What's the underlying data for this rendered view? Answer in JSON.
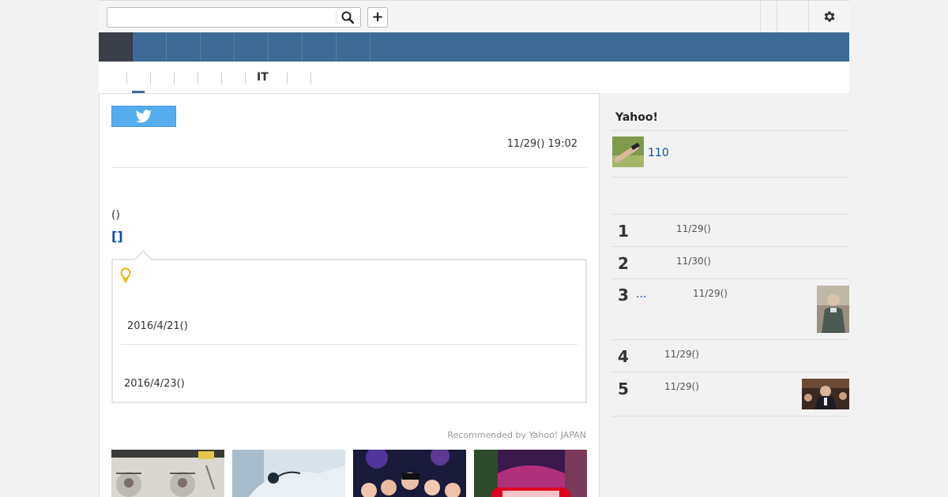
{
  "search": {
    "value": "",
    "placeholder": ""
  },
  "header": {
    "plus_label": "+"
  },
  "subnav": {
    "it_label": "IT"
  },
  "article": {
    "date": "11/29() 19:02",
    "paren": "()",
    "bracket_link": "[]"
  },
  "related": {
    "date1": "2016/4/21()",
    "date2": "2016/4/23()"
  },
  "recommend": {
    "credit": "Recommended by Yahoo! JAPAN"
  },
  "sidebar": {
    "heading": "Yahoo!",
    "ad_link": "110",
    "ranking": [
      {
        "rank": "1",
        "date": "11/29()"
      },
      {
        "rank": "2",
        "date": "11/30()"
      },
      {
        "rank": "3",
        "title": "...",
        "date": "11/29()"
      },
      {
        "rank": "4",
        "date": "11/29()"
      },
      {
        "rank": "5",
        "date": "11/29()"
      }
    ]
  },
  "icons": [
    "search-icon",
    "plus-icon",
    "gear-icon",
    "twitter-icon",
    "lightbulb-icon"
  ],
  "colors": {
    "nav": "#3e6b95",
    "nav_active": "#3a3f4a",
    "twitter": "#55acee",
    "link": "#0b4fa8",
    "bulb": "#f0b400"
  }
}
